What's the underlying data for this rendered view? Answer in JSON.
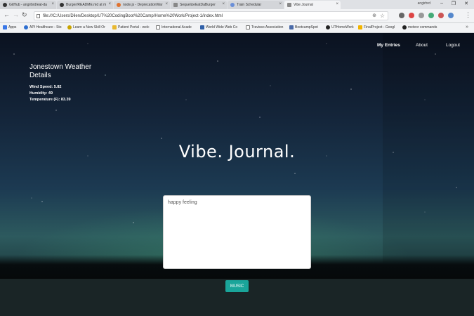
{
  "browser": {
    "tabs": [
      {
        "title": "GitHub - angirbrd/eat-da",
        "icon": "github-icon"
      },
      {
        "title": "Burger/README.md at m",
        "icon": "github-icon"
      },
      {
        "title": "node.js - DeprecationWar",
        "icon": "stackoverflow-icon"
      },
      {
        "title": "SequelizeEatDaBurger",
        "icon": "page-icon"
      },
      {
        "title": "Train Schedular",
        "icon": "train-icon"
      },
      {
        "title": "Vibe Journal",
        "icon": "page-icon"
      }
    ],
    "profile": "angirbrd",
    "url": "file:///C:/Users/Dilen/Desktop/UT%20CodingBoot%20Camp/Home%20Work/Project-1/index.html",
    "bookmarks": [
      {
        "label": "Apps",
        "icon": "apps-icon"
      },
      {
        "label": "API Healthcare - Sto",
        "icon": "api-icon"
      },
      {
        "label": "Learn a New Skill Or",
        "icon": "learn-icon"
      },
      {
        "label": "Patient Portal - welc",
        "icon": "folder-icon"
      },
      {
        "label": "International Acade",
        "icon": "page-icon"
      },
      {
        "label": "World Wide Web Co",
        "icon": "w3c-icon"
      },
      {
        "label": "Travisso Association",
        "icon": "page-icon"
      },
      {
        "label": "BootcampSpot",
        "icon": "bootcamp-icon"
      },
      {
        "label": "UTHomeWork",
        "icon": "github-icon"
      },
      {
        "label": "FinalProject - Googl",
        "icon": "drive-icon"
      },
      {
        "label": "meteor commands",
        "icon": "github-icon"
      }
    ]
  },
  "nav": {
    "my_entries": "My Entries",
    "about": "About",
    "logout": "Logout"
  },
  "weather": {
    "title": "Jonestown Weather Details",
    "wind": "Wind Speed: 5.82",
    "humidity": "Humidity: 49",
    "temperature": "Temperature (F): 83.39"
  },
  "hero": {
    "title": "Vibe. Journal."
  },
  "journal": {
    "value": "happy feeling",
    "button_label": "MUSIC"
  }
}
